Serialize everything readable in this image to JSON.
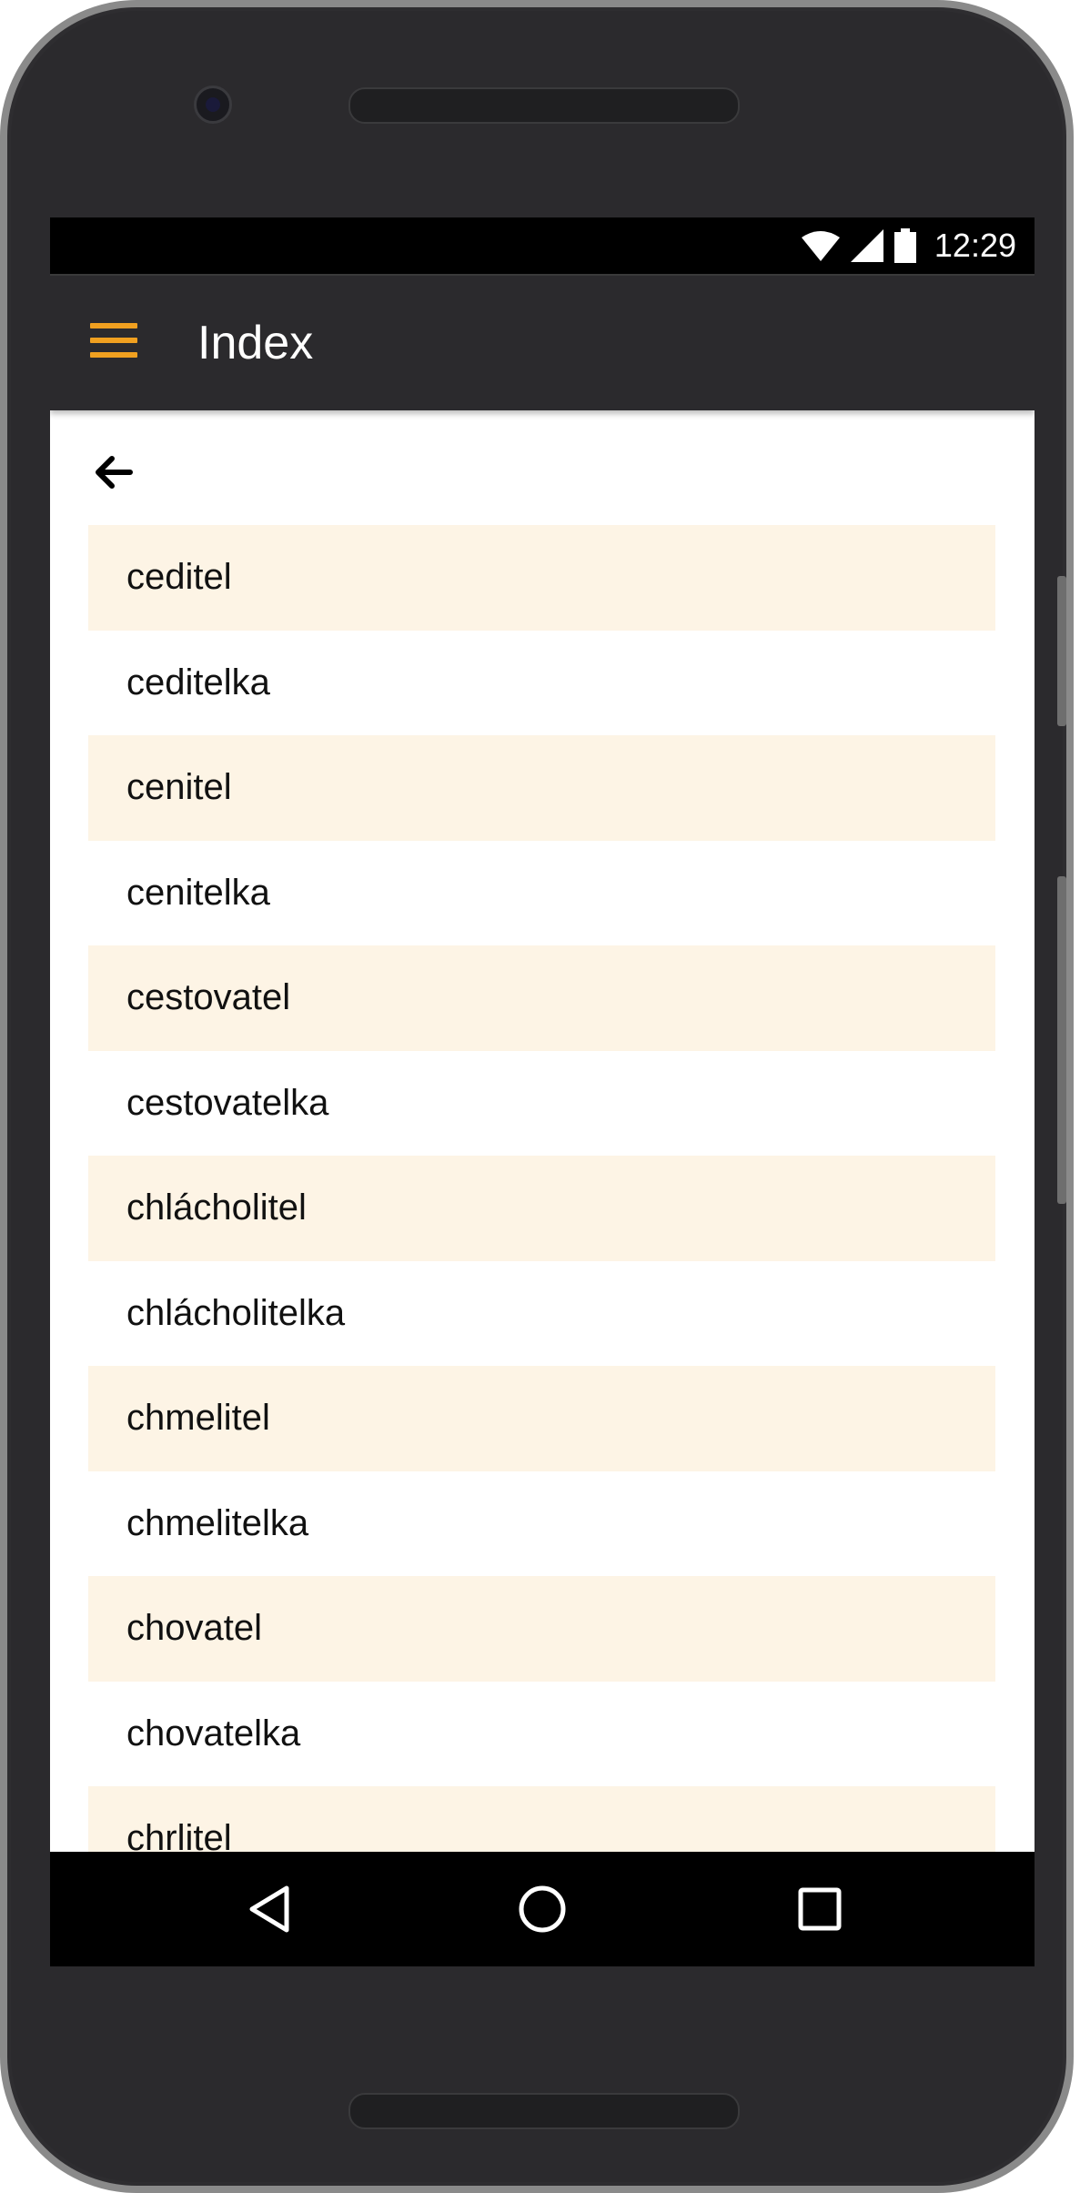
{
  "status_bar": {
    "time": "12:29"
  },
  "app_bar": {
    "title": "Index"
  },
  "list": {
    "items": [
      {
        "label": "ceditel"
      },
      {
        "label": "ceditelka"
      },
      {
        "label": "cenitel"
      },
      {
        "label": "cenitelka"
      },
      {
        "label": "cestovatel"
      },
      {
        "label": "cestovatelka"
      },
      {
        "label": "chlácholitel"
      },
      {
        "label": "chlácholitelka"
      },
      {
        "label": "chmelitel"
      },
      {
        "label": "chmelitelka"
      },
      {
        "label": "chovatel"
      },
      {
        "label": "chovatelka"
      },
      {
        "label": "chrlitel"
      }
    ]
  },
  "colors": {
    "accent": "#f0a020",
    "app_bar": "#2b2a2d",
    "row_highlight": "#fdf4e5"
  },
  "icons": {
    "menu": "hamburger-menu-icon",
    "back": "arrow-left-icon",
    "wifi": "wifi-icon",
    "signal": "cell-signal-icon",
    "battery": "battery-icon",
    "nav_back": "triangle-back-icon",
    "nav_home": "circle-home-icon",
    "nav_recents": "square-recents-icon"
  }
}
